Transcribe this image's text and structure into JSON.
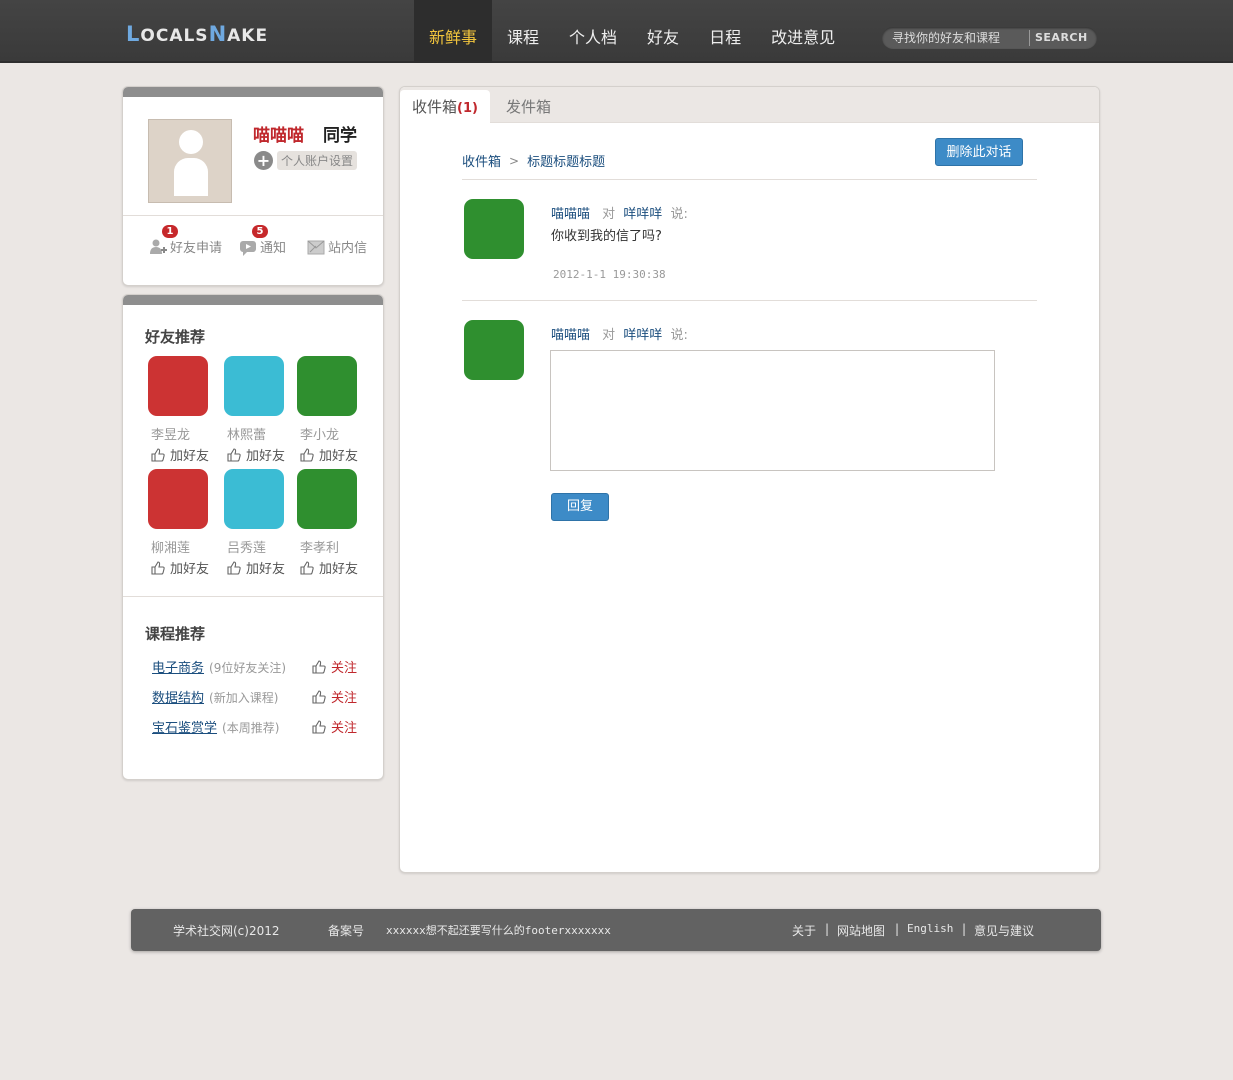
{
  "logo": {
    "part1": "L",
    "part2": "OCALS",
    "part3": "N",
    "part4": "AKE"
  },
  "nav": [
    {
      "label": "新鲜事"
    },
    {
      "label": "课程"
    },
    {
      "label": "个人档"
    },
    {
      "label": "好友"
    },
    {
      "label": "日程"
    },
    {
      "label": "改进意见"
    }
  ],
  "search": {
    "placeholder": "寻找你的好友和课程",
    "button": "Search"
  },
  "profile": {
    "name": "喵喵喵",
    "type": "同学",
    "settings_label": "个人账户设置",
    "links": [
      {
        "label": "好友申请",
        "badge": "1",
        "icon": "add-friend-icon"
      },
      {
        "label": "通知",
        "badge": "5",
        "icon": "notification-icon"
      },
      {
        "label": "站内信",
        "badge": "",
        "icon": "mail-icon"
      }
    ]
  },
  "friends_title": "好友推荐",
  "add_friend_label": "加好友",
  "friends": [
    {
      "name": "李昱龙",
      "color": "#cc3333"
    },
    {
      "name": "林熙蕾",
      "color": "#3bbcd4"
    },
    {
      "name": "李小龙",
      "color": "#2f8f2f"
    },
    {
      "name": "柳湘莲",
      "color": "#cc3333"
    },
    {
      "name": "吕秀莲",
      "color": "#3bbcd4"
    },
    {
      "name": "李孝利",
      "color": "#2f8f2f"
    }
  ],
  "courses_title": "课程推荐",
  "follow_label": "关注",
  "courses": [
    {
      "name": "电子商务",
      "desc": "(9位好友关注)"
    },
    {
      "name": "数据结构",
      "desc": "(新加入课程)"
    },
    {
      "name": "宝石鉴赏学",
      "desc": "(本周推荐)"
    }
  ],
  "tabs": {
    "inbox": "收件箱",
    "inbox_count": "(1)",
    "outbox": "发件箱"
  },
  "breadcrumb": {
    "root": "收件箱",
    "current": "标题标题标题"
  },
  "delete_button": "删除此对话",
  "message": {
    "from": "喵喵喵",
    "to_word": "对",
    "to": "咩咩咩",
    "says": "说:",
    "body": "你收到我的信了吗?",
    "time": "2012-1-1 19:30:38",
    "avatar_color": "#2f8f2f"
  },
  "reply": {
    "from": "喵喵喵",
    "to_word": "对",
    "to": "咩咩咩",
    "says": "说:",
    "button": "回复",
    "value": ""
  },
  "footer": {
    "copyright": "学术社交网(c)2012",
    "icp": "备案号",
    "text": "xxxxxx想不起还要写什么的footerxxxxxxx",
    "links": [
      "关于",
      "网站地图",
      "English",
      "意见与建议"
    ],
    "sep": "|"
  },
  "colors": {
    "accent": "#3d8bc7",
    "brand_red": "#c0282d",
    "nav_active": "#f2c53d"
  }
}
